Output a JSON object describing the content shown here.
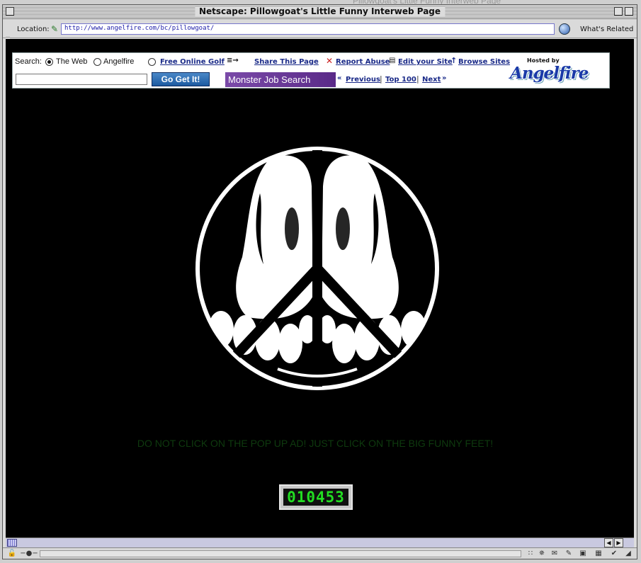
{
  "desktop": {
    "background_title": "Pillowgoat's Little Funny Interweb Page"
  },
  "window": {
    "title": "Netscape: Pillowgoat's Little Funny Interweb Page"
  },
  "location": {
    "label": "Location:",
    "url": "http://www.angelfire.com/bc/pillowgoat/",
    "whats_related": "What's Related"
  },
  "adbar": {
    "search_label": "Search:",
    "option_web": "The Web",
    "option_angelfire": "Angelfire",
    "selected_option": "The Web",
    "free_golf": "Free Online Golf",
    "share": "Share This Page",
    "report": "Report Abuse",
    "edit": "Edit your Site",
    "browse": "Browse Sites",
    "go_button": "Go Get It!",
    "monster": "Monster Job Search",
    "previous": "Previous",
    "top100": "Top 100",
    "next": "Next",
    "hosted_by": "Hosted by",
    "brand": "Angelfire"
  },
  "page": {
    "warning": "DO NOT CLICK ON THE POP UP AD! JUST CLICK ON THE BIG FUNNY FEET!",
    "counter": "010453"
  },
  "colors": {
    "page_background": "#000000",
    "warning_text": "#0e3a0e",
    "counter_digits": "#22dd22",
    "link": "#1a2a88"
  },
  "icons": [
    "page-icon",
    "globe-icon",
    "report-x-icon",
    "edit-doc-icon",
    "up-arrow-icon",
    "peace-sign-feet-image",
    "lock-icon"
  ]
}
